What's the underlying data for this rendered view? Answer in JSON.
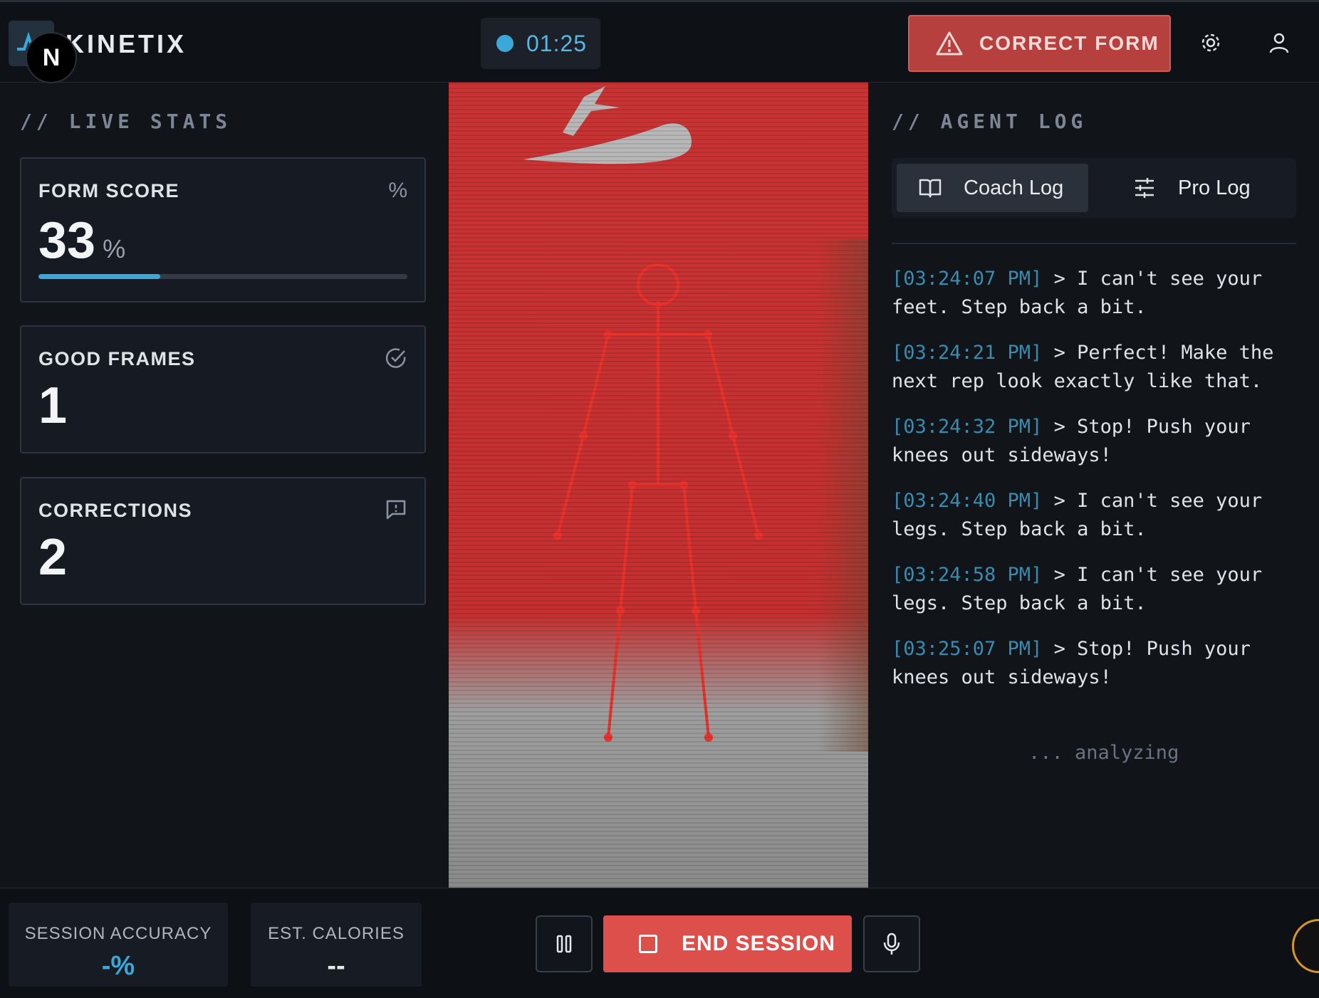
{
  "header": {
    "brand": "KINETIX",
    "badge_letter": "N",
    "timer": "01:25",
    "alert_label": "CORRECT FORM"
  },
  "live_stats": {
    "title": "// LIVE STATS",
    "form_score": {
      "label": "FORM SCORE",
      "icon_text": "%",
      "value": "33",
      "unit": "%",
      "progress_percent": 33
    },
    "good_frames": {
      "label": "GOOD FRAMES",
      "value": "1"
    },
    "corrections": {
      "label": "CORRECTIONS",
      "value": "2"
    }
  },
  "agent_log": {
    "title": "// AGENT LOG",
    "tabs": [
      {
        "label": "Coach Log",
        "active": true
      },
      {
        "label": "Pro Log",
        "active": false
      }
    ],
    "entries": [
      {
        "ts": "[03:24:07 PM]",
        "text": " > I can't see your feet. Step back a bit."
      },
      {
        "ts": "[03:24:21 PM]",
        "text": " > Perfect! Make the next rep look exactly like that."
      },
      {
        "ts": "[03:24:32 PM]",
        "text": " > Stop! Push your knees out sideways!"
      },
      {
        "ts": "[03:24:40 PM]",
        "text": " > I can't see your legs. Step back a bit."
      },
      {
        "ts": "[03:24:58 PM]",
        "text": " > I can't see your legs. Step back a bit."
      },
      {
        "ts": "[03:25:07 PM]",
        "text": " > Stop! Push your knees out sideways!"
      }
    ],
    "status": "... analyzing"
  },
  "footer": {
    "session_accuracy": {
      "label": "SESSION ACCURACY",
      "value": "-%"
    },
    "est_calories": {
      "label": "EST. CALORIES",
      "value": "--"
    },
    "end_session_label": "END SESSION"
  },
  "colors": {
    "accent": "#3aa8d8",
    "alert": "#b5403d",
    "end_button": "#dc4f4a",
    "skeleton": "#e8322b"
  }
}
